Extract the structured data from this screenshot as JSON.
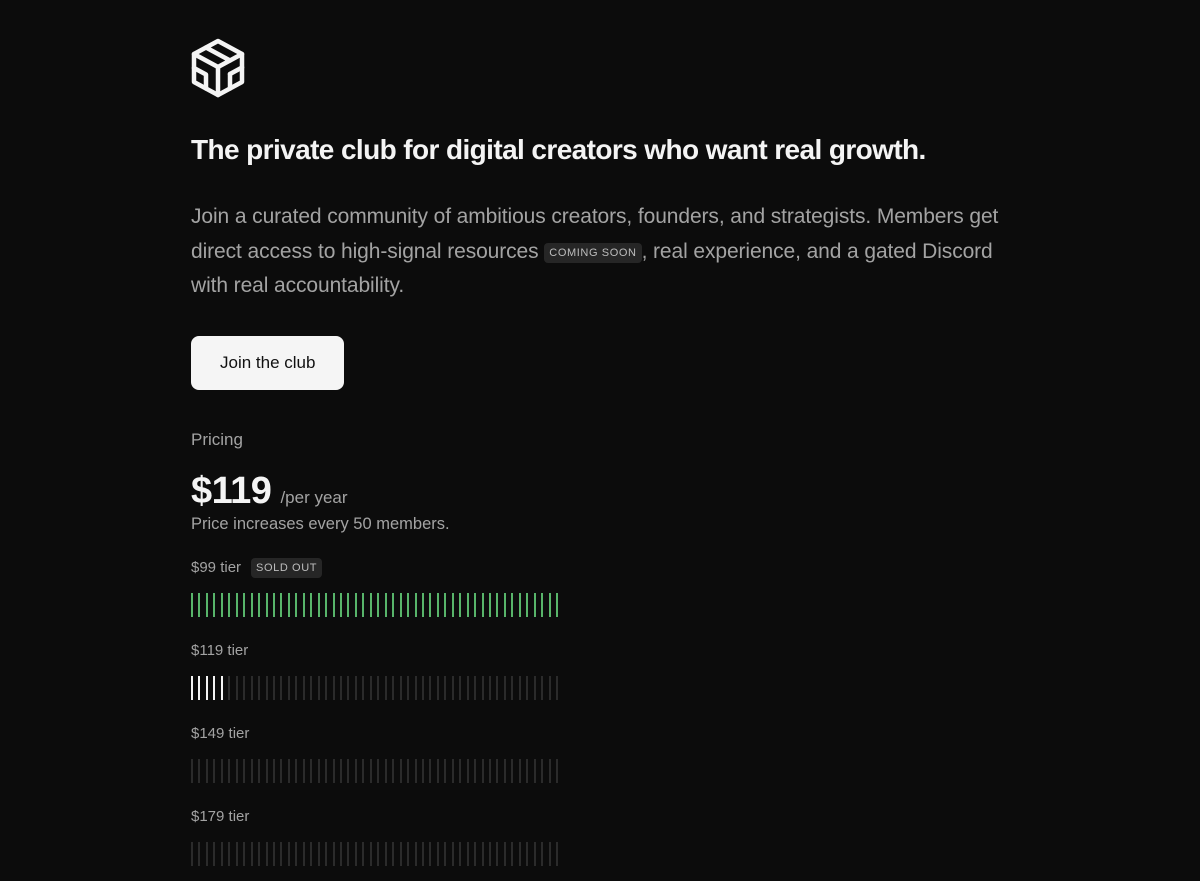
{
  "logo": {
    "icon": "cube-logo-icon"
  },
  "hero": {
    "headline": "The private club for digital creators who want real growth.",
    "intro_part1": "Join a curated community of ambitious creators, founders, and strategists. Members get direct access to high-signal resources",
    "coming_soon_badge": "COMING SOON",
    "intro_part2": ", real experience, and a gated Discord with real accountability."
  },
  "cta": {
    "label": "Join the club"
  },
  "pricing": {
    "label": "Pricing",
    "price": "$119",
    "period": "/per year",
    "increase_note": "Price increases every 50 members.",
    "tiers": [
      {
        "label": "$99 tier",
        "badge": "SOLD OUT",
        "filled": 50,
        "total": 50,
        "state": "sold"
      },
      {
        "label": "$119 tier",
        "badge": "",
        "filled": 5,
        "total": 50,
        "state": "current"
      },
      {
        "label": "$149 tier",
        "badge": "",
        "filled": 0,
        "total": 50,
        "state": "upcoming"
      },
      {
        "label": "$179 tier",
        "badge": "",
        "filled": 0,
        "total": 50,
        "state": "upcoming"
      }
    ]
  },
  "colors": {
    "background": "#0c0c0c",
    "sold_bar": "#58b56a",
    "current_bar": "#f4f4f4",
    "empty_bar": "#2b2b2b"
  }
}
